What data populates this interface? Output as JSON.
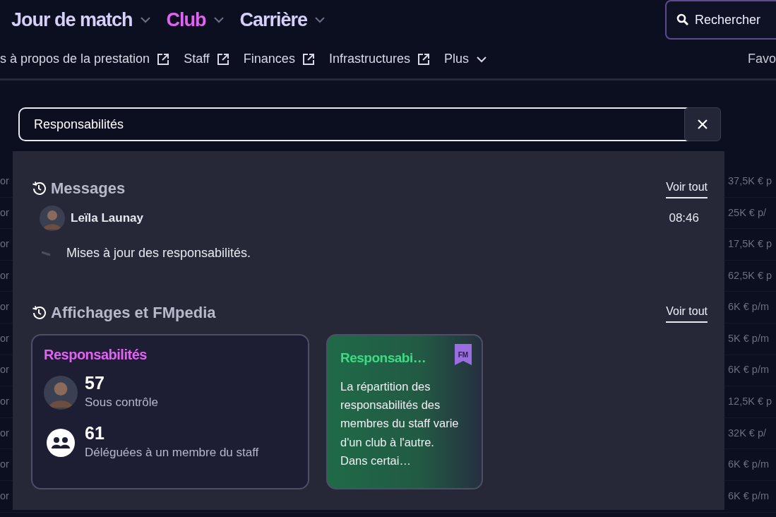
{
  "top_tabs": [
    {
      "label": "Jour de match",
      "selected": false
    },
    {
      "label": "Club",
      "selected": true
    },
    {
      "label": "Carrière",
      "selected": false
    }
  ],
  "search_button": {
    "label": "Rechercher"
  },
  "sub_nav": {
    "links": [
      {
        "label": "s à propos de la prestation",
        "kind": "external"
      },
      {
        "label": "Staff",
        "kind": "external"
      },
      {
        "label": "Finances",
        "kind": "external"
      },
      {
        "label": "Infrastructures",
        "kind": "external"
      },
      {
        "label": "Plus",
        "kind": "menu"
      }
    ],
    "right_label": "Favo"
  },
  "background_table": {
    "rows": [
      {
        "column_1": "or",
        "contract": "37,5K € p"
      },
      {
        "column_1": "or",
        "contract": "25K € p/"
      },
      {
        "column_1": "or",
        "contract": "17,5K € p"
      },
      {
        "column_1": "or",
        "contract": "62,5K € p"
      },
      {
        "column_1": "or",
        "contract": "6K € p/m"
      },
      {
        "column_1": "or",
        "contract": "5K € p/m"
      },
      {
        "column_1": "or",
        "contract": "6K € p/m"
      },
      {
        "column_1": "or",
        "contract": "12,5K € p"
      },
      {
        "column_1": "or",
        "contract": "32K € p/"
      },
      {
        "column_1": "or",
        "contract": "6K € p/m"
      },
      {
        "column_1": "or",
        "contract": "6K € p/m"
      }
    ]
  },
  "search": {
    "value": "Responsabilités"
  },
  "results": {
    "messages": {
      "title": "Messages",
      "see_all": "Voir tout",
      "items": [
        {
          "sender": "Leïla Launay",
          "time": "08:46",
          "text": "Mises à jour des responsabilités."
        }
      ]
    },
    "views": {
      "title": "Affichages et FMpedia",
      "see_all": "Voir tout",
      "cards": [
        {
          "kind": "view",
          "title": "Responsabilités",
          "stats": [
            {
              "kind": "person",
              "value": "57",
              "label": "Sous contrôle"
            },
            {
              "kind": "group",
              "value": "61",
              "label": "Déléguées à un membre du staff"
            }
          ]
        },
        {
          "kind": "fmpedia",
          "title": "Responsabi…",
          "badge": "FM",
          "text": "La répartition des responsabilités des membres du staff varie d'un club à l'autre. Dans certai…"
        }
      ]
    }
  }
}
